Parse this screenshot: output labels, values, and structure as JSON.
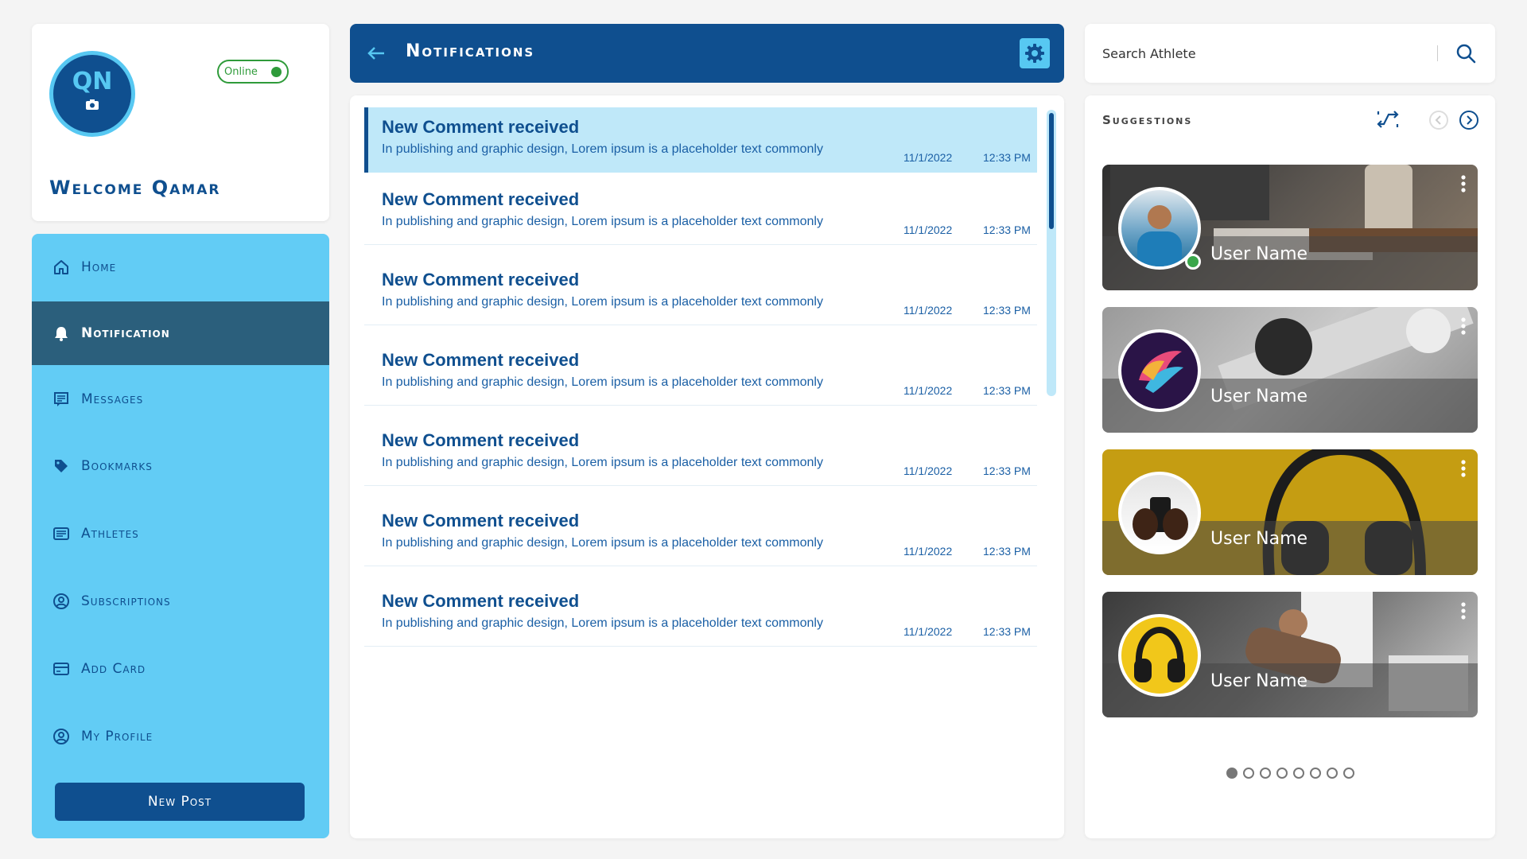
{
  "profile": {
    "initials": "QN",
    "status": "Online",
    "welcome": "Welcome Qamar"
  },
  "sidebar": {
    "items": [
      {
        "label": "Home",
        "icon": "home-icon"
      },
      {
        "label": "Notification",
        "icon": "bell-icon"
      },
      {
        "label": "Messages",
        "icon": "message-icon"
      },
      {
        "label": "Bookmarks",
        "icon": "tag-icon"
      },
      {
        "label": "Athletes",
        "icon": "list-icon"
      },
      {
        "label": "Subscriptions",
        "icon": "user-circle-icon"
      },
      {
        "label": "Add Card",
        "icon": "card-icon"
      },
      {
        "label": "My Profile",
        "icon": "user-circle-icon"
      }
    ],
    "active_index": 1,
    "new_post": "New Post"
  },
  "notifications": {
    "title": "Notifications",
    "items": [
      {
        "title": "New Comment received",
        "text": "In publishing and graphic design, Lorem ipsum is a placeholder text commonly",
        "date": "11/1/2022",
        "time": "12:33 PM"
      },
      {
        "title": "New Comment received",
        "text": "In publishing and graphic design, Lorem ipsum is a placeholder text commonly",
        "date": "11/1/2022",
        "time": "12:33 PM"
      },
      {
        "title": "New Comment received",
        "text": "In publishing and graphic design, Lorem ipsum is a placeholder text commonly",
        "date": "11/1/2022",
        "time": "12:33 PM"
      },
      {
        "title": "New Comment received",
        "text": "In publishing and graphic design, Lorem ipsum is a placeholder text commonly",
        "date": "11/1/2022",
        "time": "12:33 PM"
      },
      {
        "title": "New Comment received",
        "text": "In publishing and graphic design, Lorem ipsum is a placeholder text commonly",
        "date": "11/1/2022",
        "time": "12:33 PM"
      },
      {
        "title": "New Comment received",
        "text": "In publishing and graphic design, Lorem ipsum is a placeholder text commonly",
        "date": "11/1/2022",
        "time": "12:33 PM"
      },
      {
        "title": "New Comment received",
        "text": "In publishing and graphic design, Lorem ipsum is a placeholder text commonly",
        "date": "11/1/2022",
        "time": "12:33 PM"
      }
    ]
  },
  "search": {
    "placeholder": "Search Athlete"
  },
  "suggestions": {
    "title": "Suggestions",
    "users": [
      {
        "name": "User Name",
        "online": true
      },
      {
        "name": "User Name",
        "online": false
      },
      {
        "name": "User Name",
        "online": false
      },
      {
        "name": "User Name",
        "online": false
      }
    ],
    "page_count": 8,
    "current_page": 1
  },
  "colors": {
    "primary": "#0f4f8f",
    "accent": "#57c8f2",
    "sidebar": "#62ccf5",
    "active_nav": "#2b5f7c",
    "online": "#2f9b3a"
  }
}
